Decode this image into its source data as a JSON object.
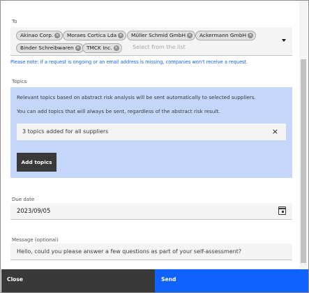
{
  "to_section": {
    "label": "To",
    "recipients": [
      "Akinao Corp.",
      "Moraes Cortica Lda",
      "Müller Schmid GmbH",
      "Ackermann GmbH",
      "Binder Schreibwaren",
      "TMCK Inc."
    ],
    "placeholder": "Select from the list",
    "note": "Please note: if a request is ongoing or an email address is missing, companies won't receive a request."
  },
  "topics_section": {
    "label": "Topics",
    "info_line1": "Relevant topics based on abstract risk analysis will be sent automatically to selected suppliers.",
    "info_line2": "You can add topics that will always be sent, regardless of the abstract risk result.",
    "added_summary": "3 topics added for all suppliers",
    "remove_symbol": "×",
    "add_button": "Add topics"
  },
  "due_date": {
    "label": "Due date",
    "value": "2023/09/05",
    "icon": "calendar-icon"
  },
  "message": {
    "label": "Message (optional)",
    "value": "Hello, could you please answer a few questions as part of your self-assessment?"
  },
  "footer": {
    "close_label": "Close",
    "send_label": "Send"
  },
  "colors": {
    "primary": "#0f62fe",
    "dark_button": "#393939",
    "topics_panel": "#c5d6fb",
    "field_bg": "#f4f4f4"
  }
}
